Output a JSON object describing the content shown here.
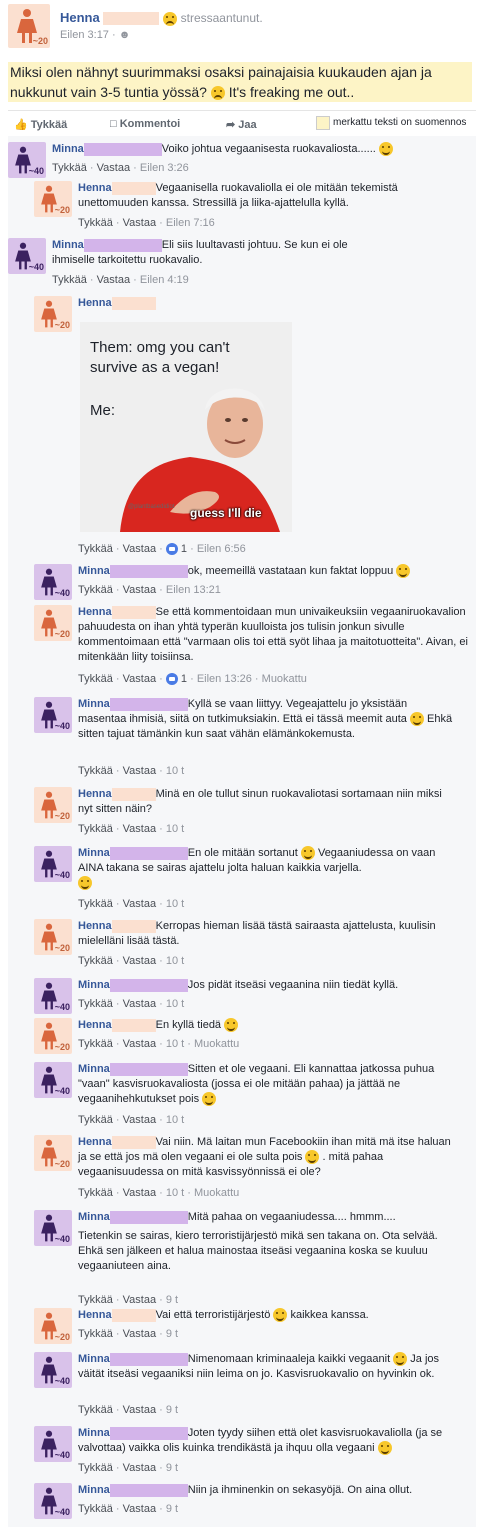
{
  "post": {
    "author": "Henna",
    "feeling": "stressaantunut.",
    "time": "Eilen 3:17",
    "audience_sep": "·",
    "text": "Miksi olen nähnyt suurimmaksi osaksi painajaisia kuukauden ajan ja nukkunut vain 3-5 tuntia yössä?",
    "text_tail": "It's freaking me out..",
    "avatar_age": "~20"
  },
  "actions": {
    "like": "Tykkää",
    "comment": "Kommentoi",
    "share": "Jaa",
    "legend": "merkattu teksti on suomennos"
  },
  "labels": {
    "like": "Tykkää",
    "reply": "Vastaa",
    "sep": "·",
    "edited": "Muokattu",
    "henna": "Henna",
    "minna": "Minna",
    "age_h": "~20",
    "age_m": "~40"
  },
  "comments": [
    {
      "who": "minna",
      "text": "Voiko johtua vegaanisesta ruokavaliosta......",
      "time": "Eilen 3:26"
    },
    {
      "who": "henna",
      "text": "Vegaanisella ruokavaliolla ei ole mitään tekemistä unettomuuden kanssa. Stressillä ja liika-ajattelulla kyllä.",
      "time": "Eilen 7:16"
    },
    {
      "who": "minna",
      "text": "Eli siis luultavasti johtuu. Se kun ei ole ihmiselle tarkoitettu ruokavalio.",
      "time": "Eilen 4:19"
    },
    {
      "who": "henna",
      "text": "",
      "time": "Eilen 6:56",
      "likes": "1"
    },
    {
      "who": "minna",
      "text": "ok, meemeillä vastataan kun faktat loppuu",
      "time": "Eilen 13:21"
    },
    {
      "who": "henna",
      "text": "Se että kommentoidaan mun univaikeuksiin vegaaniruokavalion pahuudesta on ihan yhtä typerän kuulloista jos tulisin jonkun sivulle kommentoimaan että \"varmaan olis toi että syöt lihaa ja maitotuotteita\". Aivan, ei mitenkään liity toisiinsa.",
      "time": "Eilen 13:26",
      "likes": "1",
      "edited": true
    },
    {
      "who": "minna",
      "text": "Kyllä se vaan liittyy. Vegeajattelu jo yksistään masentaa ihmisiä, siitä on tutkimuksiakin. Että ei tässä meemit auta",
      "text2": "Ehkä sitten tajuat tämänkin kun saat vähän elämänkokemusta.",
      "time": "10 t"
    },
    {
      "who": "henna",
      "text": "Minä en ole tullut sinun ruokavaliotasi sortamaan niin miksi nyt sitten näin?",
      "time": "10 t"
    },
    {
      "who": "minna",
      "text": "En ole mitään sortanut",
      "text2": "Vegaaniudessa on vaan AINA takana se sairas ajattelu jolta haluan kaikkia varjella.",
      "time": "10 t"
    },
    {
      "who": "henna",
      "text": "Kerropas hieman lisää tästä sairaasta ajattelusta, kuulisin mielelläni lisää tästä.",
      "time": "10 t"
    },
    {
      "who": "minna",
      "text": "Jos pidät itseäsi vegaanina niin tiedät kyllä.",
      "time": "10 t"
    },
    {
      "who": "henna",
      "text": "En kyllä tiedä",
      "time": "10 t",
      "edited": true
    },
    {
      "who": "minna",
      "text": "Sitten et ole vegaani. Eli kannattaa jatkossa puhua \"vaan\" kasvisruokavaliosta (jossa ei ole mitään pahaa) ja jättää ne vegaanihehkutukset pois",
      "time": "10 t"
    },
    {
      "who": "henna",
      "text": "Vai niin. Mä laitan mun Facebookiin ihan mitä mä itse haluan ja se että jos mä olen vegaani ei ole sulta pois",
      "text2": ". mitä pahaa vegaanisuudessa on mitä kasvissyönnissä ei ole?",
      "time": "10 t",
      "edited": true
    },
    {
      "who": "minna",
      "text": "Mitä pahaa on vegaaniudessa.... hmmm....",
      "text2": "Tietenkin se sairas, kiero terroristijärjestö mikä sen takana on. Ota selvää. Ehkä sen jälkeen et halua mainostaa itseäsi vegaanina koska se kuuluu vegaaniuteen aina.",
      "time": "9 t"
    },
    {
      "who": "henna",
      "text": "Vai että terroristijärjestö",
      "text2": "kaikkea kanssa.",
      "time": "9 t"
    },
    {
      "who": "minna",
      "text": "Nimenomaan kriminaaleja kaikki vegaanit",
      "text2": "Ja jos väität itseäsi vegaaniksi niin leima on jo. Kasvisruokavalio on hyvinkin ok.",
      "time": "9 t"
    },
    {
      "who": "minna",
      "text": "Joten tyydy siihen että olet kasvisruokavaliolla (ja se valvottaa) vaikka olis kuinka trendikästä ja ihquu olla vegaani",
      "time": "9 t"
    },
    {
      "who": "minna",
      "text": "Niin ja ihminenkin on sekasyöjä. On aina ollut.",
      "time": "9 t"
    }
  ],
  "meme": {
    "line1": "Them: omg you can't survive as a vegan!",
    "line2": "Me:",
    "caption": "guess I'll die",
    "watermark": "@plantbasedidiot"
  }
}
